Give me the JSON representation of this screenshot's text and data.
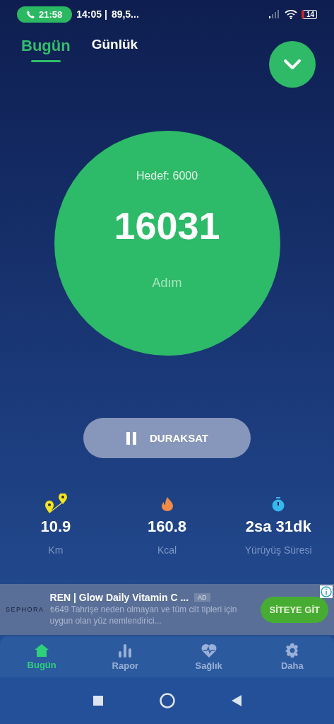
{
  "status_bar": {
    "call_time": "21:58",
    "time": "14:05 |",
    "extra": "89,5...",
    "battery": "14"
  },
  "tabs": [
    {
      "label": "Bugün",
      "selected": true
    },
    {
      "label": "Günlük",
      "selected": false
    }
  ],
  "steps": {
    "goal": "Hedef: 6000",
    "count": "16031",
    "unit": "Adım"
  },
  "pause_button": {
    "label": "DURAKSAT"
  },
  "stats": [
    {
      "kind": "distance",
      "value": "10.9",
      "label": "Km"
    },
    {
      "kind": "calories",
      "value": "160.8",
      "label": "Kcal"
    },
    {
      "kind": "duration",
      "value": "2sa 31dk",
      "label": "Yürüyüş Süresi"
    }
  ],
  "ad": {
    "brand": "SEPHORA",
    "title": "REN | Glow Daily Vitamin C ...",
    "badge": "AD",
    "text": "₺649 Tahrişe neden olmayan ve tüm cilt tipleri için uygun olan yüz nemlendirici...",
    "button": "SİTEYE GİT"
  },
  "bottom_nav": [
    {
      "kind": "home",
      "label": "Bugün",
      "selected": true
    },
    {
      "kind": "chart",
      "label": "Rapor",
      "selected": false
    },
    {
      "kind": "health",
      "label": "Sağlık",
      "selected": false
    },
    {
      "kind": "settings",
      "label": "Daha",
      "selected": false
    }
  ]
}
